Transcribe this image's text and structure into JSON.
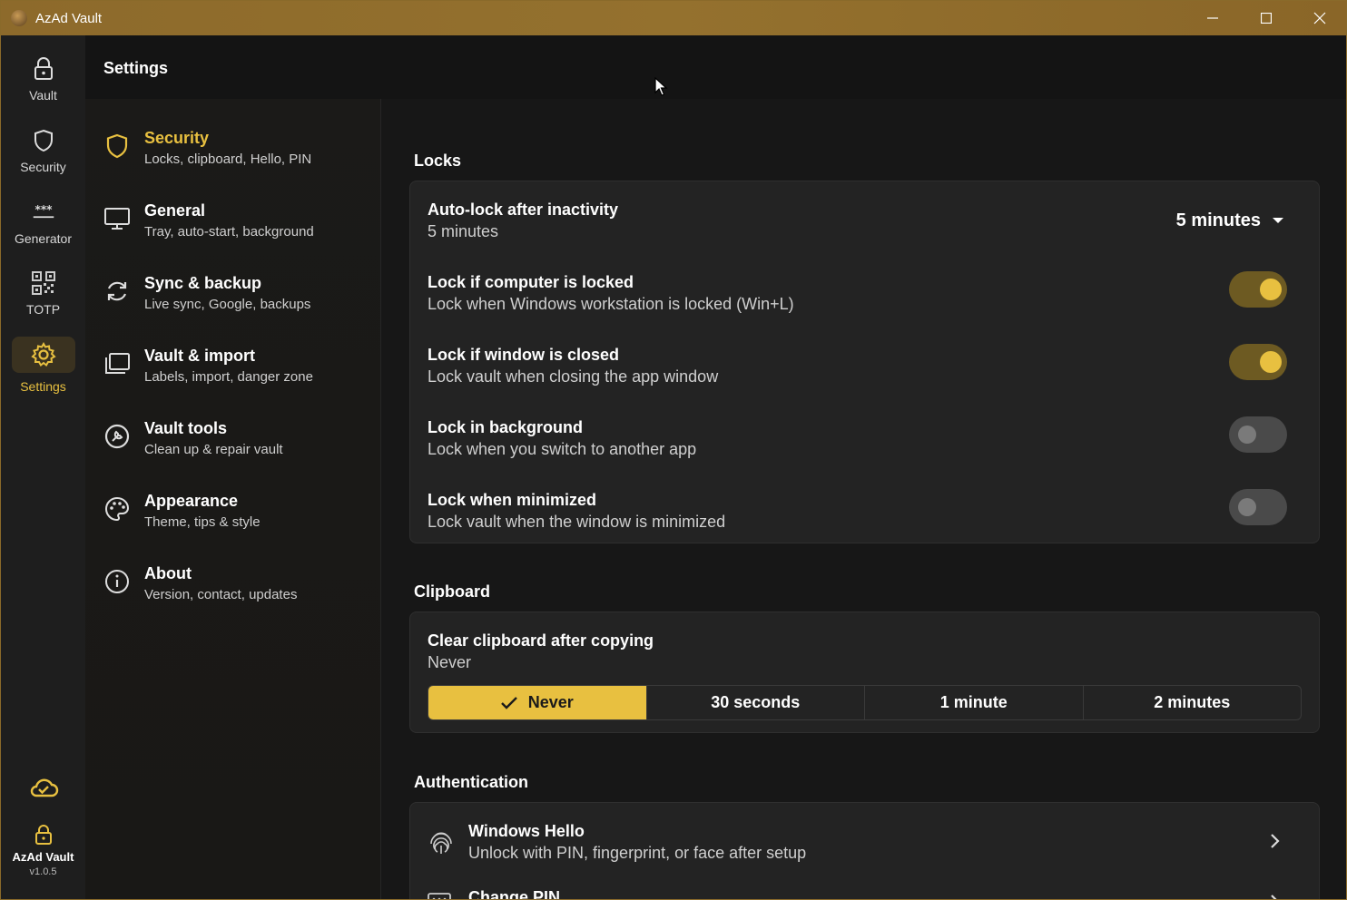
{
  "window": {
    "title": "AzAd Vault",
    "accent": "#e8c040",
    "titlebar_color": "#8d6a2b"
  },
  "rail": {
    "items": [
      {
        "label": "Vault",
        "icon": "lock-icon"
      },
      {
        "label": "Security",
        "icon": "shield-icon"
      },
      {
        "label": "Generator",
        "icon": "password-icon"
      },
      {
        "label": "TOTP",
        "icon": "qr-code-icon"
      },
      {
        "label": "Settings",
        "icon": "gear-icon",
        "active": true
      }
    ],
    "footer": {
      "name": "AzAd Vault",
      "version": "v1.0.5"
    }
  },
  "settings": {
    "title": "Settings",
    "categories": [
      {
        "title": "Security",
        "subtitle": "Locks, clipboard, Hello, PIN",
        "icon": "shield-icon",
        "active": true
      },
      {
        "title": "General",
        "subtitle": "Tray, auto-start, background",
        "icon": "monitor-icon"
      },
      {
        "title": "Sync & backup",
        "subtitle": "Live sync, Google, backups",
        "icon": "sync-icon"
      },
      {
        "title": "Vault & import",
        "subtitle": "Labels, import, danger zone",
        "icon": "folder-stack-icon"
      },
      {
        "title": "Vault tools",
        "subtitle": "Clean up & repair vault",
        "icon": "wrench-icon"
      },
      {
        "title": "Appearance",
        "subtitle": "Theme, tips & style",
        "icon": "palette-icon"
      },
      {
        "title": "About",
        "subtitle": "Version, contact, updates",
        "icon": "info-icon"
      }
    ]
  },
  "locks": {
    "section_title": "Locks",
    "auto_lock": {
      "title": "Auto-lock after inactivity",
      "subtitle": "5 minutes",
      "selected": "5 minutes"
    },
    "toggles": [
      {
        "title": "Lock if computer is locked",
        "subtitle": "Lock when Windows workstation is locked (Win+L)",
        "on": true
      },
      {
        "title": "Lock if window is closed",
        "subtitle": "Lock vault when closing the app window",
        "on": true
      },
      {
        "title": "Lock in background",
        "subtitle": "Lock when you switch to another app",
        "on": false
      },
      {
        "title": "Lock when minimized",
        "subtitle": "Lock vault when the window is minimized",
        "on": false
      }
    ]
  },
  "clipboard": {
    "section_title": "Clipboard",
    "title": "Clear clipboard after copying",
    "subtitle": "Never",
    "options": [
      "Never",
      "30 seconds",
      "1 minute",
      "2 minutes"
    ],
    "selected_index": 0
  },
  "authentication": {
    "section_title": "Authentication",
    "items": [
      {
        "title": "Windows Hello",
        "subtitle": "Unlock with PIN, fingerprint, or face after setup",
        "icon": "fingerprint-icon"
      },
      {
        "title": "Change PIN",
        "subtitle": "",
        "icon": "keypad-icon"
      }
    ]
  }
}
